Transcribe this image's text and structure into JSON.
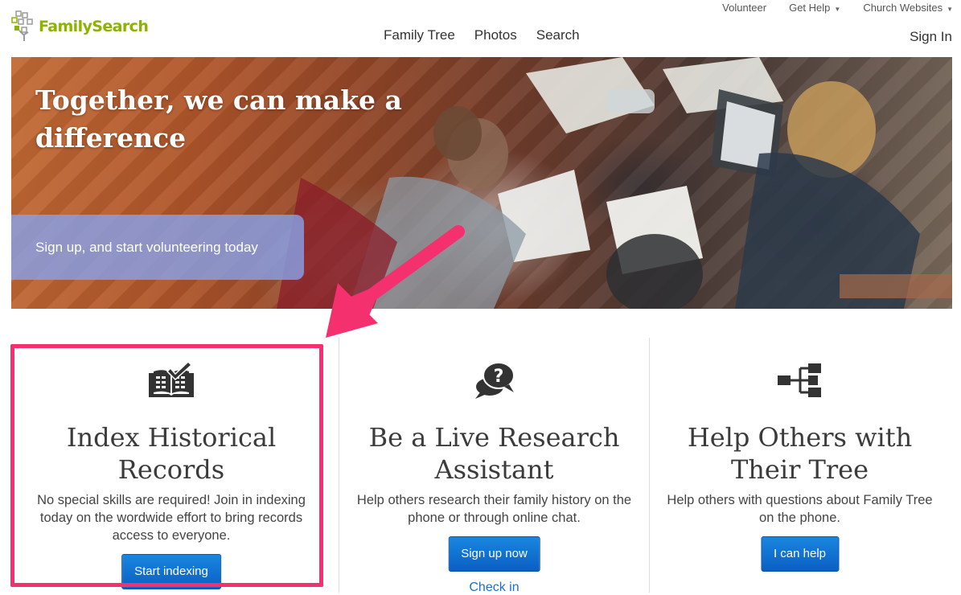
{
  "header": {
    "brand": "FamilySearch",
    "util_nav": [
      {
        "label": "Volunteer",
        "has_caret": false
      },
      {
        "label": "Get Help",
        "has_caret": true
      },
      {
        "label": "Church Websites",
        "has_caret": true
      }
    ],
    "main_nav": [
      "Family Tree",
      "Photos",
      "Search"
    ],
    "sign_in": "Sign In"
  },
  "hero": {
    "title": "Together, we can make a difference",
    "cta": "Sign up, and start volunteering today"
  },
  "columns": [
    {
      "icon": "open-book-check-icon",
      "heading": "Index Historical Records",
      "text": "No special skills are required! Join in indexing today on the wordwide effort to bring records access to everyone.",
      "button": "Start indexing"
    },
    {
      "icon": "question-chat-bubbles-icon",
      "heading": "Be a Live Research Assistant",
      "text": "Help others research their family history on the phone or through online chat.",
      "button": "Sign up now",
      "link": "Check in"
    },
    {
      "icon": "family-tree-hierarchy-icon",
      "heading": "Help Others with Their Tree",
      "text": "Help others with questions about Family Tree on the phone.",
      "button": "I can help"
    }
  ],
  "colors": {
    "brand_green": "#8cb300",
    "button_blue": "#0a6fd0",
    "highlight_pink": "#f4306e",
    "hero_cta_bg": "#87a0e6"
  }
}
